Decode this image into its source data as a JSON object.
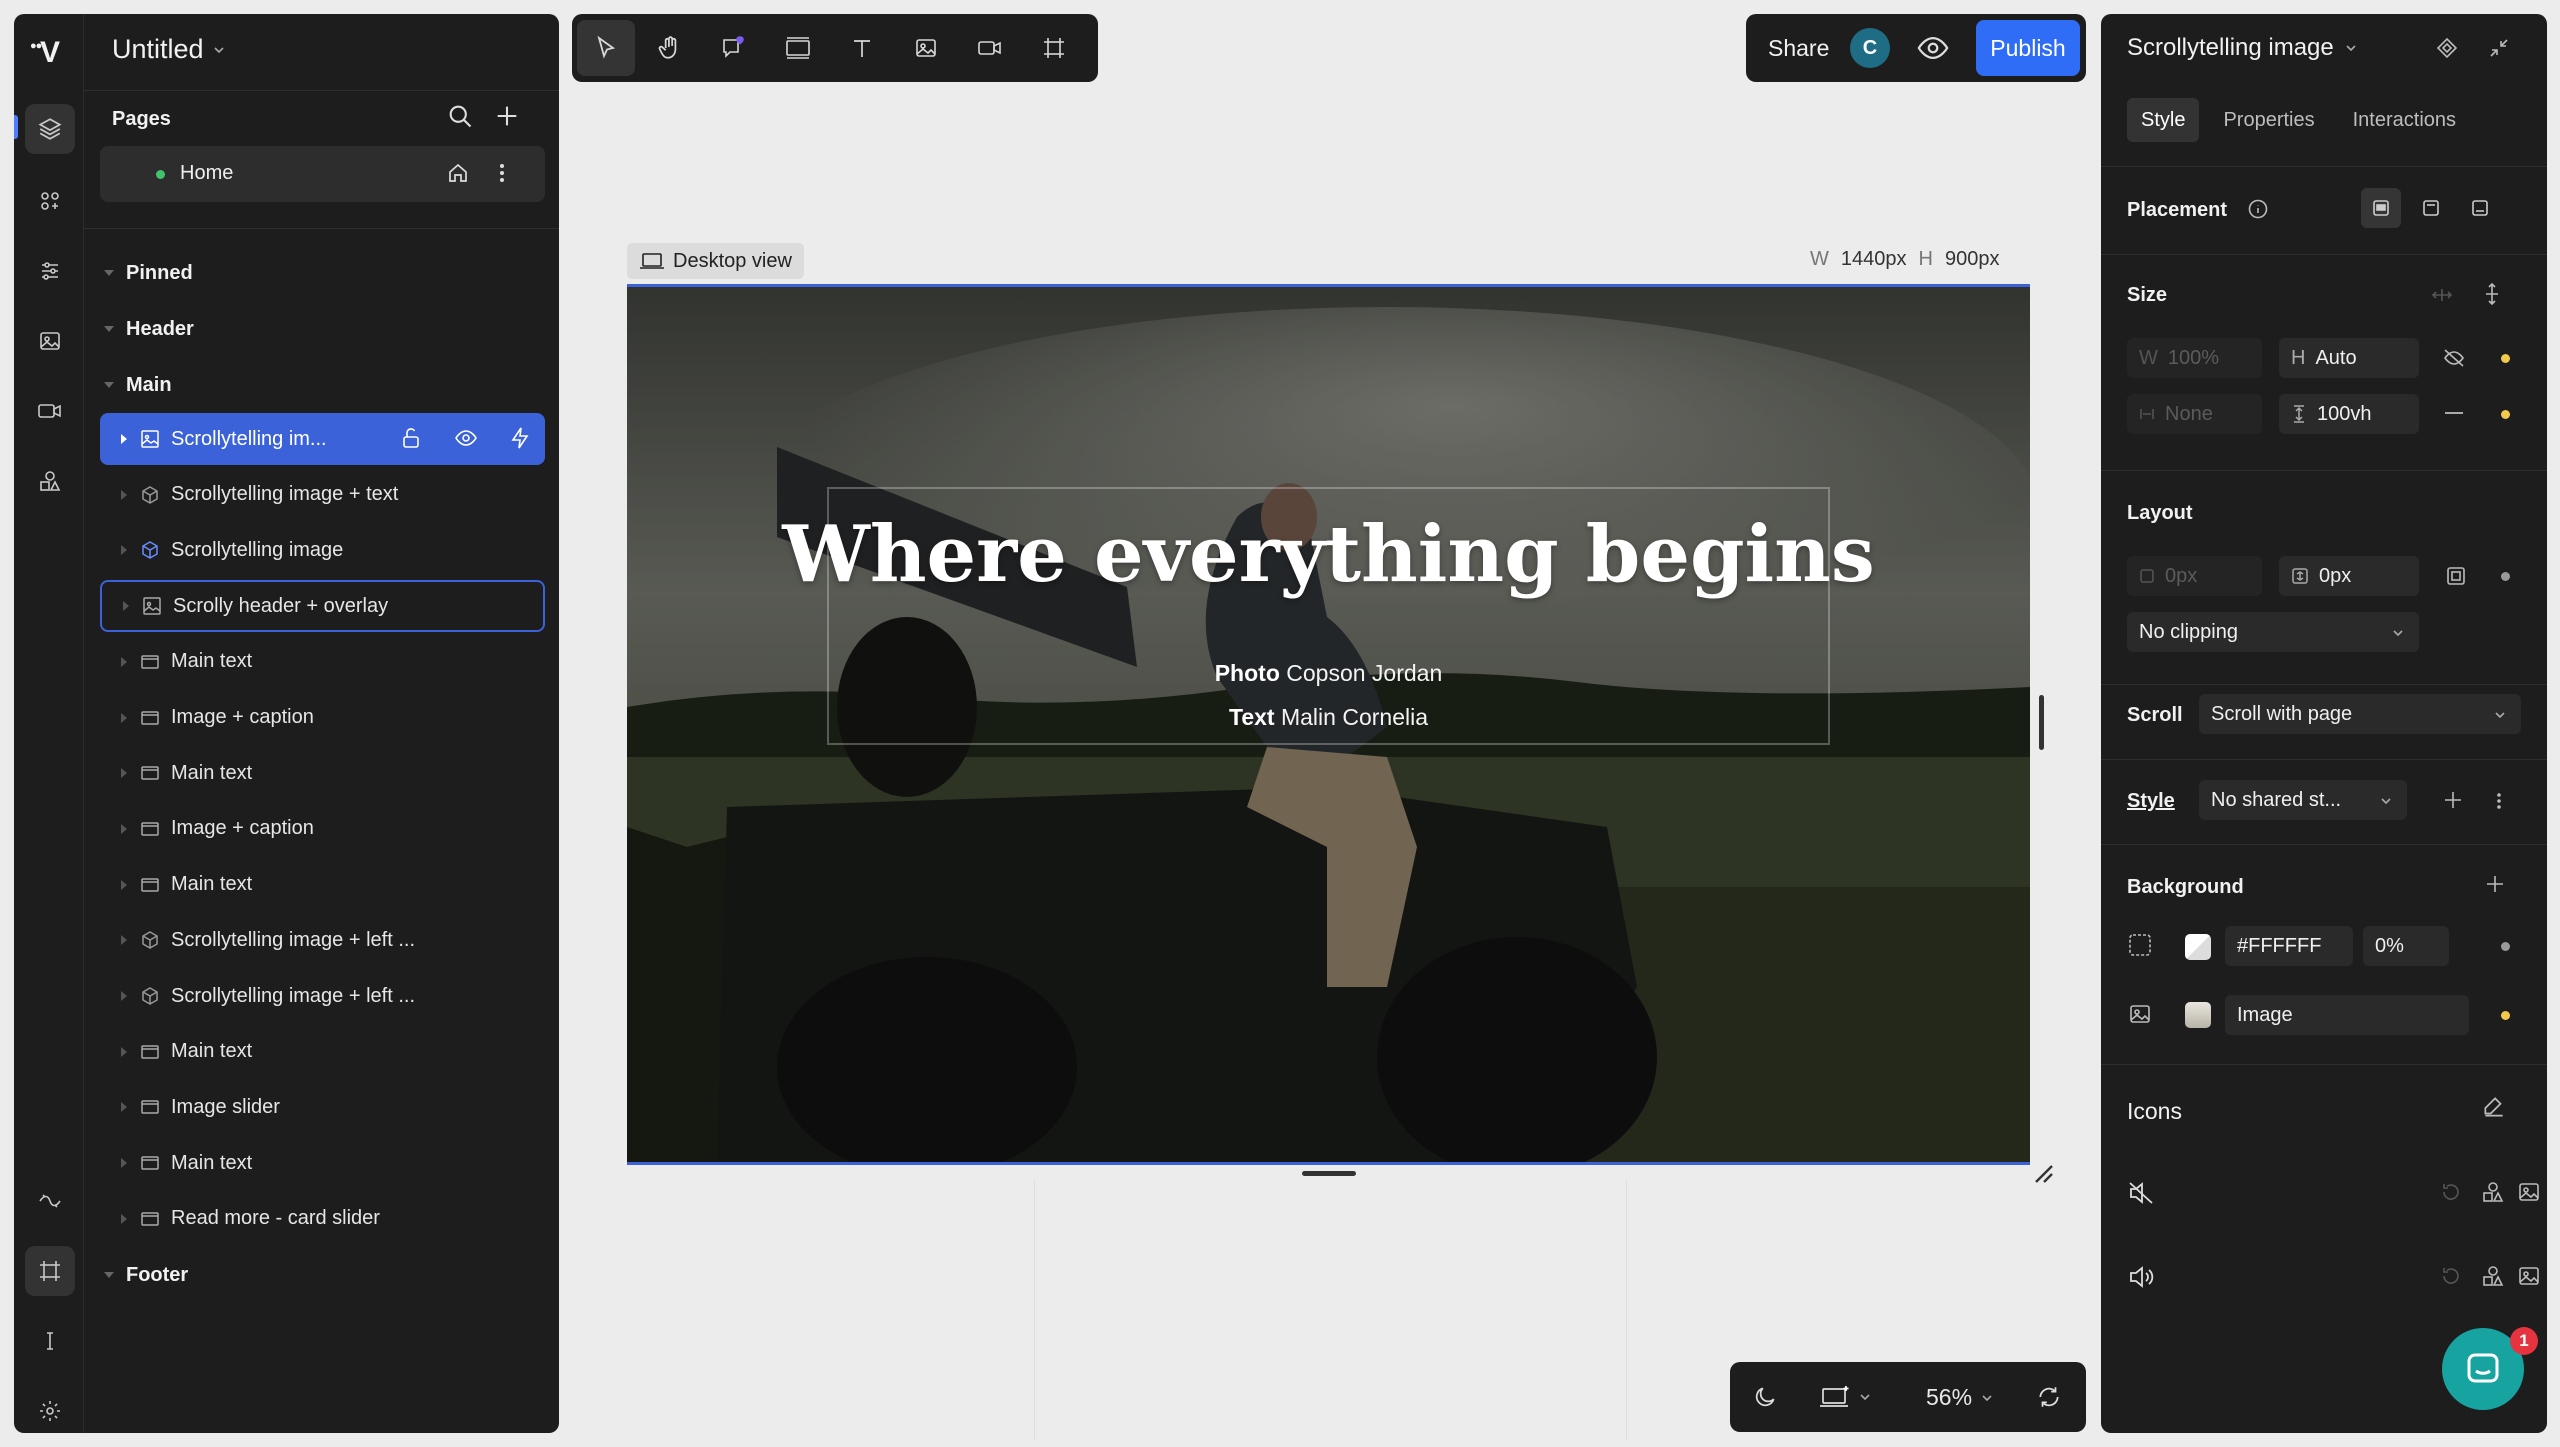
{
  "app": {
    "logo": "V",
    "project_title": "Untitled"
  },
  "pages": {
    "heading": "Pages",
    "items": [
      {
        "label": "Home"
      }
    ]
  },
  "tree": {
    "pinned": "Pinned",
    "header": "Header",
    "main": "Main",
    "footer": "Footer",
    "layers": [
      {
        "label": "Scrollytelling im...",
        "icon": "image-frame-icon",
        "state": "selected"
      },
      {
        "label": "Scrollytelling image + text",
        "icon": "component-icon"
      },
      {
        "label": "Scrollytelling image",
        "icon": "component-icon"
      },
      {
        "label": "Scrolly header + overlay",
        "icon": "image-frame-icon",
        "state": "hovered"
      },
      {
        "label": "Main text",
        "icon": "section-icon"
      },
      {
        "label": "Image + caption",
        "icon": "section-icon"
      },
      {
        "label": "Main text",
        "icon": "section-icon"
      },
      {
        "label": "Image + caption",
        "icon": "section-icon"
      },
      {
        "label": "Main text",
        "icon": "section-icon"
      },
      {
        "label": "Scrollytelling image + left ...",
        "icon": "component-icon"
      },
      {
        "label": "Scrollytelling image + left ...",
        "icon": "component-icon"
      },
      {
        "label": "Main text",
        "icon": "section-icon"
      },
      {
        "label": "Image slider",
        "icon": "section-icon"
      },
      {
        "label": "Main text",
        "icon": "section-icon"
      },
      {
        "label": "Read more - card slider",
        "icon": "section-icon"
      }
    ]
  },
  "share": {
    "label": "Share",
    "avatar_initial": "C",
    "publish_label": "Publish"
  },
  "canvas": {
    "view_label": "Desktop view",
    "width_label": "W",
    "width_value": "1440px",
    "height_label": "H",
    "height_value": "900px",
    "hero_title": "Where everything begins",
    "photo_label": "Photo",
    "photo_credit": "Copson Jordan",
    "text_label": "Text",
    "text_credit": "Malin Cornelia"
  },
  "bottombar": {
    "zoom": "56%"
  },
  "inspector": {
    "title": "Scrollytelling image",
    "tabs": [
      "Style",
      "Properties",
      "Interactions"
    ],
    "placement_label": "Placement",
    "size_label": "Size",
    "size": {
      "w_label": "W",
      "w_value": "100%",
      "h_label": "H",
      "h_value": "Auto",
      "min_value": "None",
      "max_value": "100vh"
    },
    "layout_label": "Layout",
    "layout": {
      "gap_value": "0px",
      "padding_value": "0px",
      "clipping": "No clipping"
    },
    "scroll_label": "Scroll",
    "scroll_value": "Scroll with page",
    "style_label": "Style",
    "style_value": "No shared st...",
    "background_label": "Background",
    "background": {
      "color_value": "#FFFFFF",
      "opacity_value": "0%",
      "image_label": "Image"
    },
    "icons_label": "Icons"
  },
  "chat": {
    "badge": "1"
  },
  "colors": {
    "accent": "#2f6df6",
    "selection": "#3b62d8",
    "panel": "#1d1d1d",
    "status_dot": "#f2c94c"
  }
}
